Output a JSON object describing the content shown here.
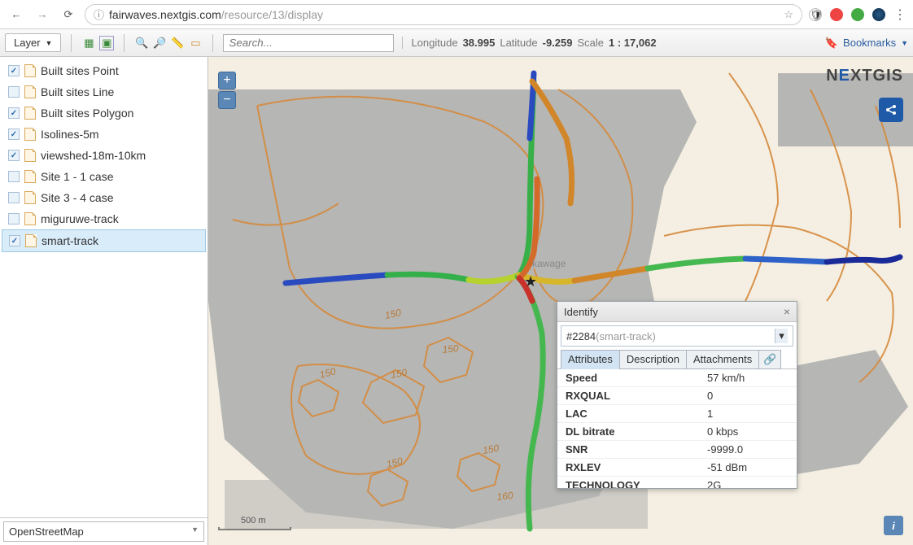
{
  "url": {
    "info_icon": "ⓘ",
    "domain": "fairwaves.nextgis.com",
    "path": "/resource/13/display"
  },
  "toolbar": {
    "layer_btn": "Layer",
    "search_placeholder": "Search...",
    "longitude_label": "Longitude",
    "longitude_val": "38.995",
    "latitude_label": "Latitude",
    "latitude_val": "-9.259",
    "scale_label": "Scale",
    "scale_val": "1 : 17,062",
    "bookmarks_label": "Bookmarks"
  },
  "layers": [
    {
      "checked": true,
      "label": "Built sites Point"
    },
    {
      "checked": false,
      "label": "Built sites Line"
    },
    {
      "checked": true,
      "label": "Built sites Polygon"
    },
    {
      "checked": true,
      "label": "Isolines-5m"
    },
    {
      "checked": true,
      "label": "viewshed-18m-10km"
    },
    {
      "checked": false,
      "label": "Site 1 - 1 case"
    },
    {
      "checked": false,
      "label": "Site 3 - 4 case"
    },
    {
      "checked": false,
      "label": "miguruwe-track"
    },
    {
      "checked": true,
      "label": "smart-track",
      "selected": true
    }
  ],
  "basemap": "OpenStreetMap",
  "logo": {
    "pre": "N",
    "e": "E",
    "post": "XTGIS"
  },
  "map": {
    "scale_text": "500 m",
    "place_label": "kawage",
    "contour_labels": [
      "150",
      "150",
      "150",
      "150",
      "150",
      "150",
      "160"
    ]
  },
  "identify": {
    "title": "Identify",
    "selection_id": "#2284",
    "selection_layer": " (smart-track)",
    "tabs": [
      "Attributes",
      "Description",
      "Attachments"
    ],
    "attrs": [
      {
        "k": "Speed",
        "v": "57 km/h"
      },
      {
        "k": "RXQUAL",
        "v": "0"
      },
      {
        "k": "LAC",
        "v": "1"
      },
      {
        "k": "DL bitrate",
        "v": "0 kbps"
      },
      {
        "k": "SNR",
        "v": "-9999.0"
      },
      {
        "k": "RXLEV",
        "v": "-51 dBm"
      },
      {
        "k": "TECHNOLOGY",
        "v": "2G"
      }
    ]
  }
}
